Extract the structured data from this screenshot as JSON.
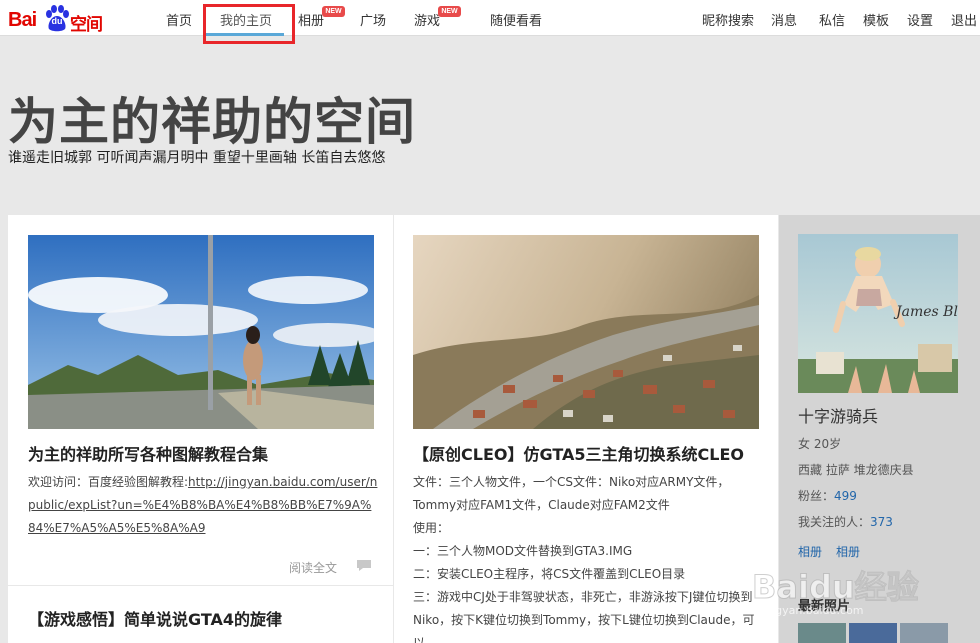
{
  "logo": {
    "bai": "Bai",
    "du": "du",
    "kongjian": "空间"
  },
  "nav": {
    "left": [
      {
        "label": "首页"
      },
      {
        "label": "我的主页"
      },
      {
        "label": "相册"
      },
      {
        "label": "广场"
      },
      {
        "label": "游戏"
      },
      {
        "label": "随便看看"
      }
    ],
    "right": [
      {
        "label": "昵称搜索"
      },
      {
        "label": "消息"
      },
      {
        "label": "私信"
      },
      {
        "label": "模板"
      },
      {
        "label": "设置"
      },
      {
        "label": "退出"
      }
    ],
    "new_badge": "NEW",
    "active_color": "#5aa8d8"
  },
  "hero": {
    "title": "为主的祥助的空间",
    "subtitle": "谁遥走旧城郭 可听闻声漏月明中 重望十里画轴 长笛自去悠悠"
  },
  "posts": [
    {
      "title": "为主的祥助所写各种图解教程合集",
      "intro": "欢迎访问：百度经验图解教程:",
      "link": "http://jingyan.baidu.com/user/npublic/expList?un=%E4%B8%BA%E4%B8%BB%E7%9A%84%E7%A5%A5%E5%8A%A9",
      "read_more": "阅读全文"
    },
    {
      "title": "【原创CLEO】仿GTA5三主角切换系统CLEO",
      "lines": [
        "文件：三个人物文件，一个CS文件：Niko对应ARMY文件，Tommy对应FAM1文件，Claude对应FAM2文件",
        "使用：",
        "一：三个人物MOD文件替换到GTA3.IMG",
        "二：安装CLEO主程序，将CS文件覆盖到CLEO目录",
        "三：游戏中CJ处于非驾驶状态，非死亡，非游泳按下J键位切换到Niko，按下K键位切换到Tommy，按下L键位切换到Claude，可以"
      ]
    },
    {
      "title": "【游戏感悟】简单说说GTA4的旋律"
    }
  ],
  "sidebar": {
    "nickname": "十字游骑兵",
    "gender_age": "女  20岁",
    "location": "西藏  拉萨  堆龙德庆县",
    "fans_label": "粉丝：",
    "fans_count": "499",
    "following_label": "我关注的人：",
    "following_count": "373",
    "links": [
      "相册",
      "相册"
    ],
    "recent_photos": "最新照片",
    "album_cover_text": "James Blunt"
  },
  "watermark": {
    "text": "Baidu经验",
    "url": "jingyan.baidu.com"
  }
}
